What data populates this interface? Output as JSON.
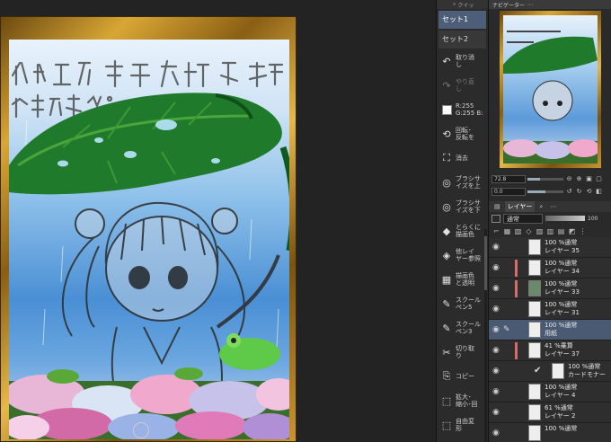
{
  "palette": {
    "header_icon": "search-icon",
    "header_label": "クイッ",
    "sets": [
      {
        "label": "セット1",
        "active": true
      },
      {
        "label": "セット2",
        "active": false
      }
    ],
    "tools": [
      {
        "icon": "undo-icon",
        "glyph": "↶",
        "label": "取り消\nし",
        "enabled": true
      },
      {
        "icon": "redo-icon",
        "glyph": "↷",
        "label": "やり直\nし",
        "enabled": false
      },
      {
        "icon": "color-swatch",
        "glyph": "",
        "label": "R:255\nG:255 B:",
        "enabled": true
      },
      {
        "icon": "rotate-icon",
        "glyph": "⟲",
        "label": "回転･\n反転を",
        "enabled": true
      },
      {
        "icon": "erase-icon",
        "glyph": "⛶",
        "label": "消去",
        "enabled": true
      },
      {
        "icon": "brush-size-icon",
        "glyph": "◎",
        "label": "ブラシサ\nイズを上",
        "enabled": true
      },
      {
        "icon": "brush-size-down-icon",
        "glyph": "◎",
        "label": "ブラシサ\nイズを下",
        "enabled": true
      },
      {
        "icon": "fill-icon",
        "glyph": "◆",
        "label": "とらくに\n描画色",
        "enabled": true
      },
      {
        "icon": "layer-fill-icon",
        "glyph": "◈",
        "label": "他レイ\nヤー参照",
        "enabled": true
      },
      {
        "icon": "clear-color-icon",
        "glyph": "▦",
        "label": "描画色\nと透明",
        "enabled": true
      },
      {
        "icon": "pen-icon",
        "glyph": "✎",
        "label": "スクール\nペン5",
        "enabled": true
      },
      {
        "icon": "pen-icon",
        "glyph": "✎",
        "label": "スクール\nペン3",
        "enabled": true
      },
      {
        "icon": "cut-icon",
        "glyph": "✂",
        "label": "切り取\nり",
        "enabled": true
      },
      {
        "icon": "copy-icon",
        "glyph": "⎘",
        "label": "コピー",
        "enabled": true
      },
      {
        "icon": "transform-icon",
        "glyph": "⬚",
        "label": "拡大･\n縮小･回",
        "enabled": true
      },
      {
        "icon": "free-transform-icon",
        "glyph": "⬚",
        "label": "自由変\n形",
        "enabled": true
      }
    ]
  },
  "navigator": {
    "title": "ナビゲーター",
    "zoom": "72.8",
    "rotation": "0.0",
    "zoom_fraction": 0.35,
    "rotation_fraction": 0.5
  },
  "layers": {
    "tab_label": "レイヤー",
    "blend_mode": "通常",
    "opacity_label": "100",
    "items": [
      {
        "percent": "100 %通常",
        "name": "レイヤー 35",
        "visible": true,
        "tag": false,
        "dark": false,
        "selected": false,
        "indent": false,
        "check": false
      },
      {
        "percent": "100 %通常",
        "name": "レイヤー 34",
        "visible": true,
        "tag": true,
        "dark": false,
        "selected": false,
        "indent": false,
        "check": false
      },
      {
        "percent": "100 %通常",
        "name": "レイヤー 33",
        "visible": true,
        "tag": true,
        "dark": true,
        "selected": false,
        "indent": false,
        "check": false
      },
      {
        "percent": "100 %通常",
        "name": "レイヤー 31",
        "visible": true,
        "tag": false,
        "dark": false,
        "selected": false,
        "indent": false,
        "check": false
      },
      {
        "percent": "100 %通常",
        "name": "用紙",
        "visible": true,
        "tag": false,
        "dark": false,
        "selected": true,
        "indent": false,
        "check": false
      },
      {
        "percent": "41 %乗算",
        "name": "レイヤー 37",
        "visible": true,
        "tag": true,
        "dark": false,
        "selected": false,
        "indent": false,
        "check": false
      },
      {
        "percent": "100 %通常",
        "name": "カードモナー",
        "visible": true,
        "tag": false,
        "dark": false,
        "selected": false,
        "indent": true,
        "check": true
      },
      {
        "percent": "100 %通常",
        "name": "レイヤー 4",
        "visible": true,
        "tag": false,
        "dark": false,
        "selected": false,
        "indent": false,
        "check": false
      },
      {
        "percent": "61 %通常",
        "name": "レイヤー 2",
        "visible": true,
        "tag": false,
        "dark": false,
        "selected": false,
        "indent": false,
        "check": false
      },
      {
        "percent": "100 %通常",
        "name": "",
        "visible": true,
        "tag": false,
        "dark": false,
        "selected": false,
        "indent": false,
        "check": false
      }
    ]
  },
  "colors": {
    "selected_row": "#4a5a73",
    "active_set": "#4d5f78",
    "gold": "#d9a635",
    "leaf": "#1f7a2c"
  }
}
